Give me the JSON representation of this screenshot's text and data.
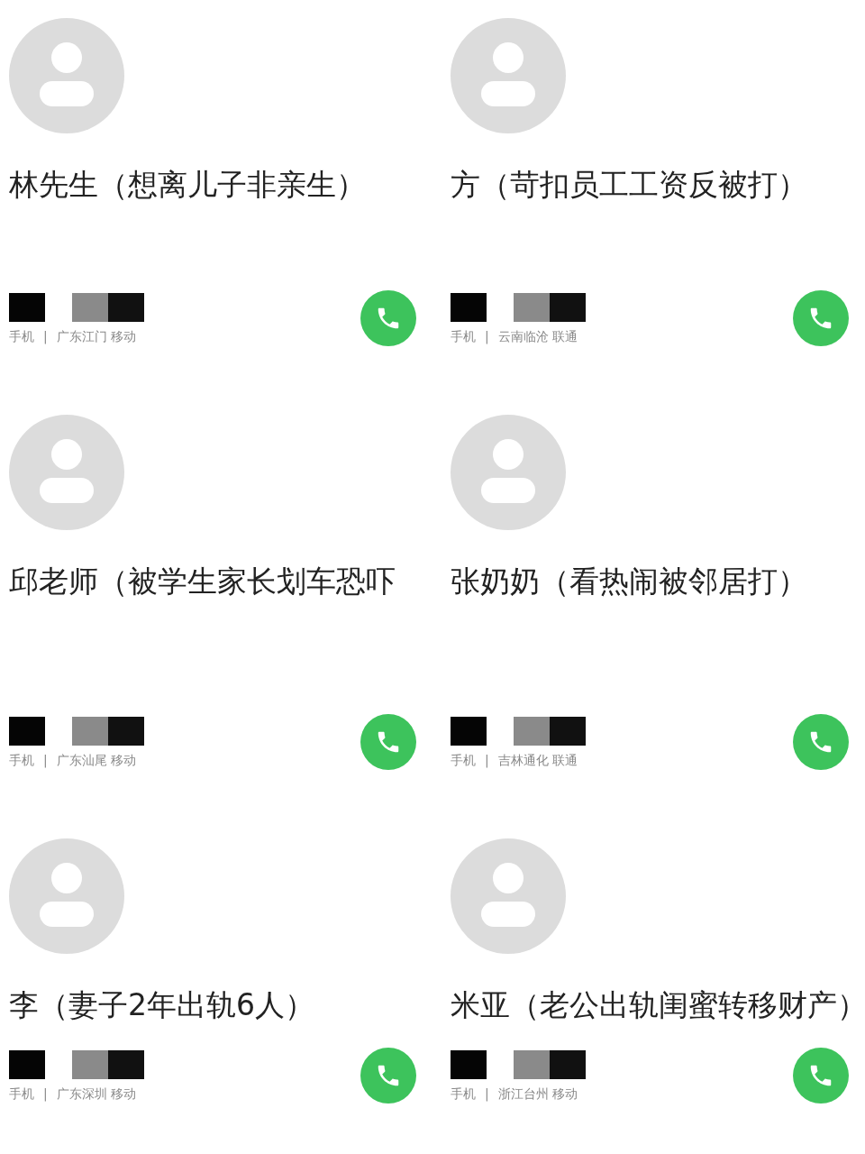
{
  "contacts": [
    {
      "name": "林先生（想离儿子非亲生）",
      "phone_type": "手机",
      "separator": "|",
      "region": "广东江门 移动"
    },
    {
      "name": "方（苛扣员工工资反被打）",
      "phone_type": "手机",
      "separator": "|",
      "region": "云南临沧 联通"
    },
    {
      "name": "邱老师（被学生家长划车恐吓",
      "phone_type": "手机",
      "separator": "|",
      "region": "广东汕尾 移动"
    },
    {
      "name": "张奶奶（看热闹被邻居打）",
      "phone_type": "手机",
      "separator": "|",
      "region": "吉林通化 联通"
    },
    {
      "name": "李（妻子2年出轨6人）",
      "phone_type": "手机",
      "separator": "|",
      "region": "广东深圳 移动"
    },
    {
      "name": "米亚（老公出轨闺蜜转移财产）",
      "phone_type": "手机",
      "separator": "|",
      "region": "浙江台州 移动"
    }
  ]
}
